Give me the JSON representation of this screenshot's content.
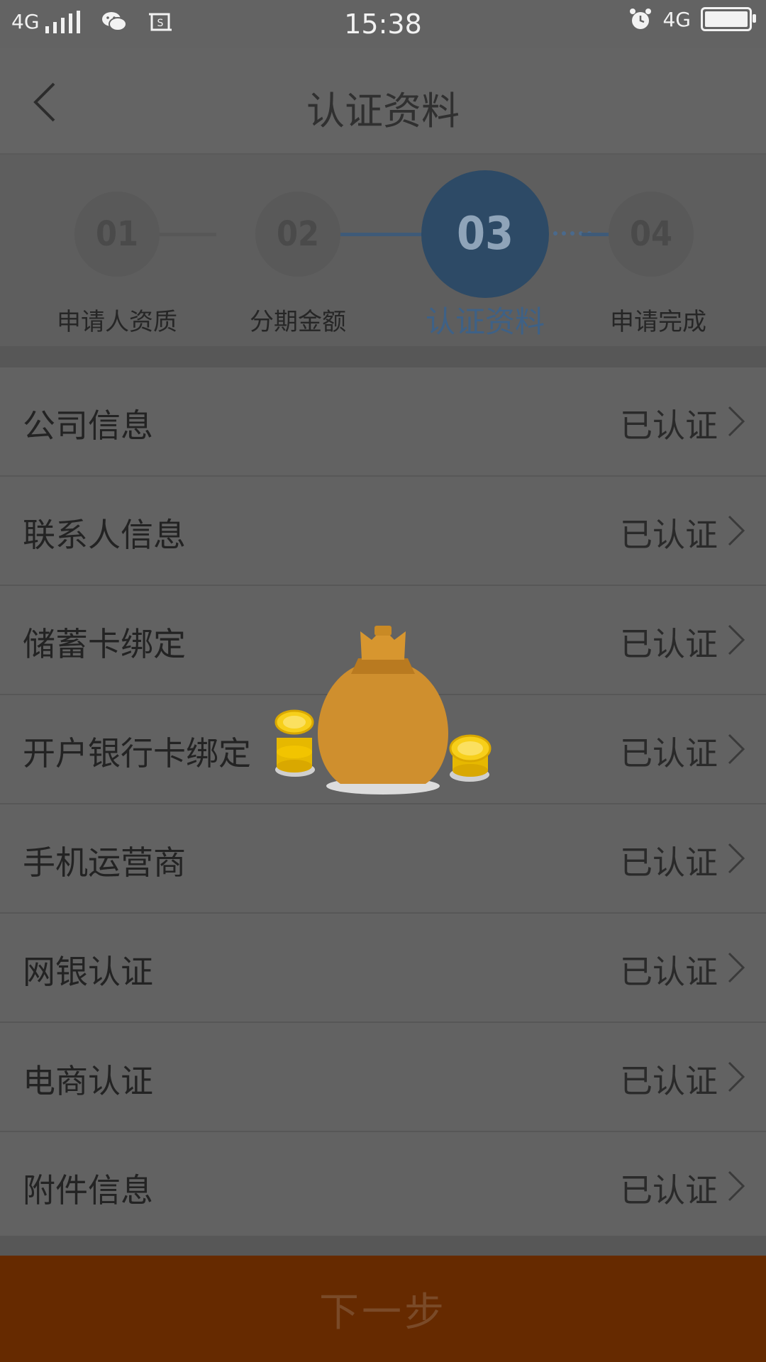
{
  "status_bar": {
    "network": "4G",
    "time": "15:38",
    "right_network": "4G"
  },
  "header": {
    "title": "认证资料",
    "back_icon": "back-arrow-icon"
  },
  "steps": [
    {
      "number": "01",
      "label": "申请人资质",
      "active": false
    },
    {
      "number": "02",
      "label": "分期金额",
      "active": false
    },
    {
      "number": "03",
      "label": "认证资料",
      "active": true
    },
    {
      "number": "04",
      "label": "申请完成",
      "active": false
    }
  ],
  "items": [
    {
      "label": "公司信息",
      "status": "已认证"
    },
    {
      "label": "联系人信息",
      "status": "已认证"
    },
    {
      "label": "储蓄卡绑定",
      "status": "已认证"
    },
    {
      "label": "开户银行卡绑定",
      "status": "已认证"
    },
    {
      "label": "手机运营商",
      "status": "已认证"
    },
    {
      "label": "网银认证",
      "status": "已认证"
    },
    {
      "label": "电商认证",
      "status": "已认证"
    },
    {
      "label": "附件信息",
      "status": "已认证"
    }
  ],
  "footer": {
    "next_label": "下一步"
  },
  "colors": {
    "accent": "#2d4a66",
    "button": "#662a00",
    "overlay": "#5f5f5f"
  },
  "overlay": {
    "icon": "money-bag-loading-icon"
  }
}
